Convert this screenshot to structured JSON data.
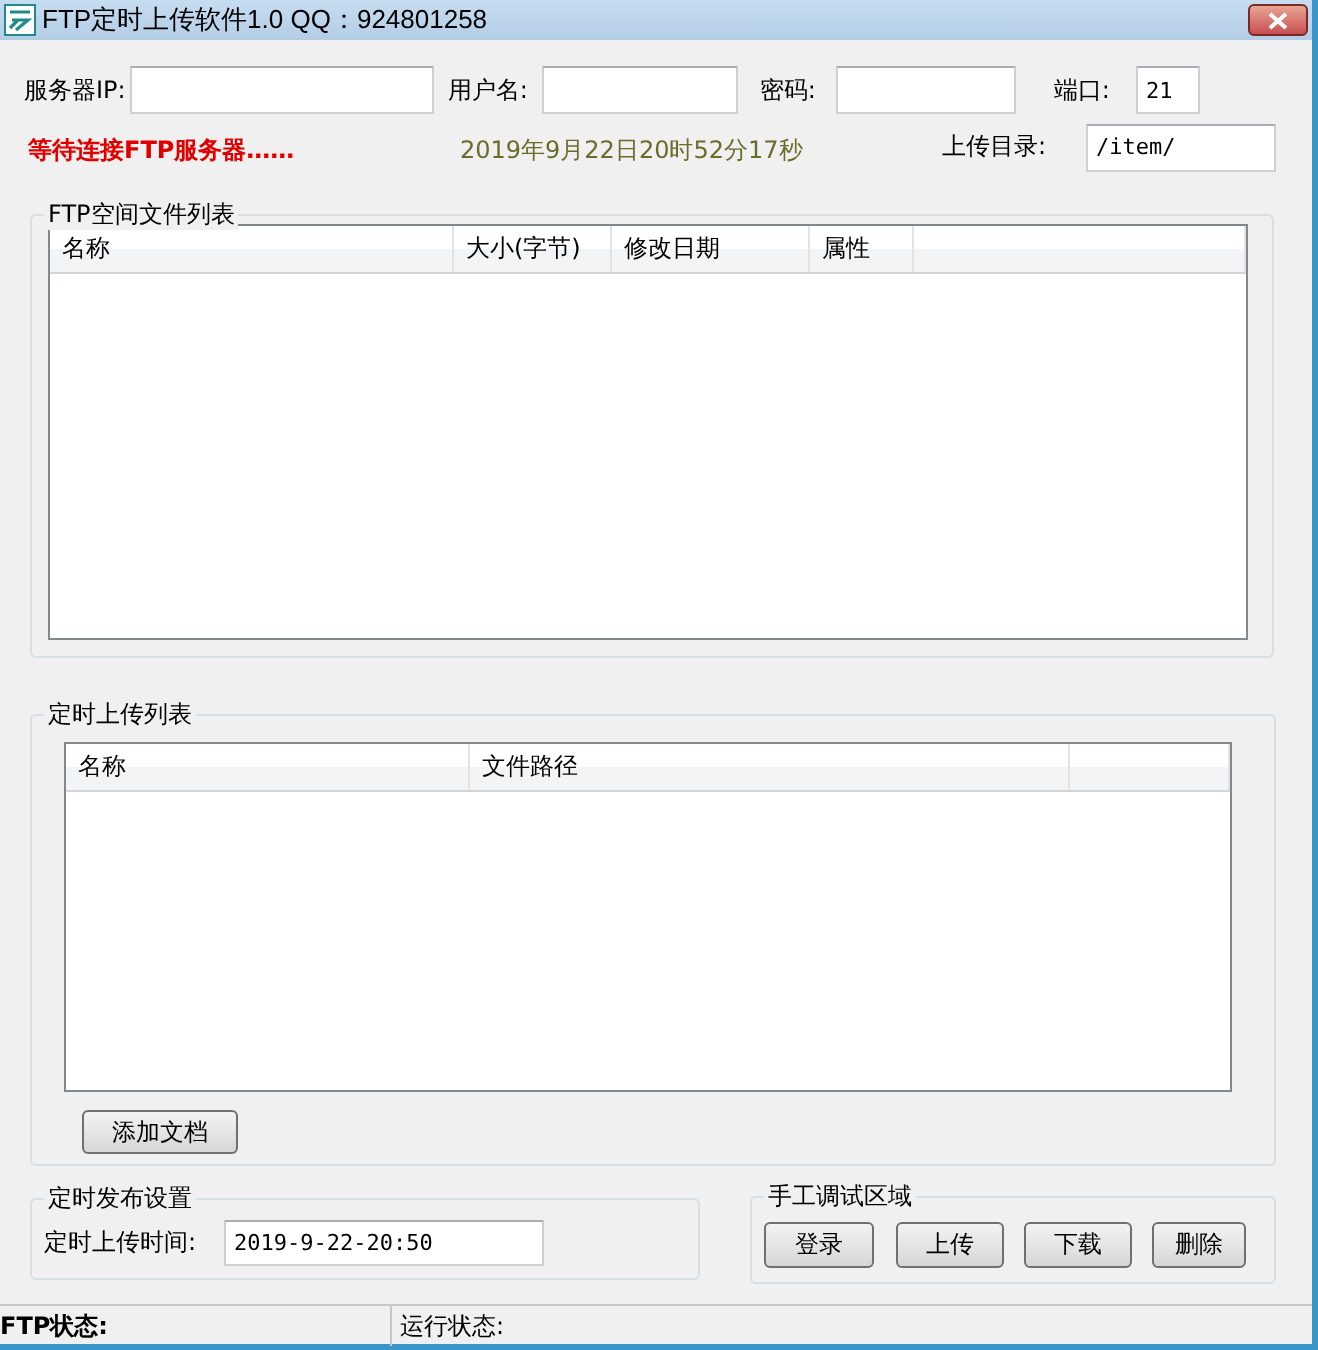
{
  "window": {
    "title": "FTP定时上传软件1.0 QQ：924801258"
  },
  "connection": {
    "fields": [
      {
        "label": "服务器IP:"
      },
      {
        "label": "用户名:"
      },
      {
        "label": "密码:"
      },
      {
        "label": "端口:",
        "value": "21"
      }
    ]
  },
  "status_message": "等待连接FTP服务器……",
  "clock": "2019年9月22日20时52分17秒",
  "upload_dir": {
    "label": "上传目录:",
    "value": "/item/"
  },
  "ftp_files": {
    "title": "FTP空间文件列表",
    "columns": [
      "名称",
      "大小(字节)",
      "修改日期",
      "属性"
    ]
  },
  "schedule_list": {
    "title": "定时上传列表",
    "columns": [
      "名称",
      "文件路径"
    ],
    "add_button": "添加文档"
  },
  "schedule_settings": {
    "title": "定时发布设置",
    "time_label": "定时上传时间:",
    "time_value": "2019-9-22-20:50"
  },
  "manual": {
    "title": "手工调试区域",
    "buttons": [
      "登录",
      "上传",
      "下载",
      "删除"
    ]
  },
  "status_bar": [
    "FTP状态:",
    "运行状态:"
  ]
}
